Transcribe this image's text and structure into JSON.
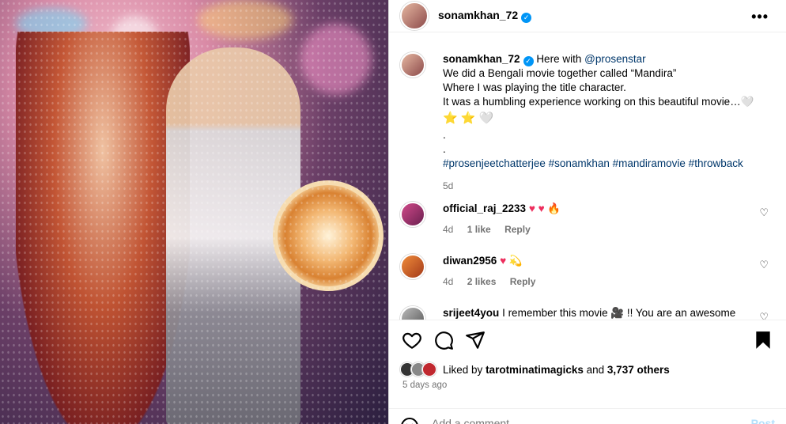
{
  "post": {
    "author": "sonamkhan_72",
    "verified": true,
    "more_label": "•••"
  },
  "caption": {
    "author": "sonamkhan_72",
    "intro": "Here with",
    "mention": "@prosenstar",
    "line1": "We did a Bengali movie together called “Mandira”",
    "line2": "Where I was playing the title character.",
    "line3": "It was a humbling experience working on this beautiful movie…",
    "emoji_line_end": "🤍",
    "emoji_row": [
      "⭐",
      "⭐",
      "🤍"
    ],
    "dot1": ".",
    "dot2": ".",
    "hashtags": "#prosenjeetchatterjee #sonamkhan #mandiramovie #throwback",
    "time": "5d"
  },
  "comments": [
    {
      "username": "official_raj_2233",
      "emojis": [
        "♥",
        "♥",
        "🔥"
      ],
      "time": "4d",
      "likes": "1 like",
      "reply_label": "Reply"
    },
    {
      "username": "diwan2956",
      "emojis": [
        "♥",
        "💫"
      ],
      "time": "4d",
      "likes": "2 likes",
      "reply_label": "Reply"
    },
    {
      "username": "srijeet4you",
      "text": "I remember this movie 🎥 !! You are an awesome"
    }
  ],
  "likes": {
    "prefix": "Liked by",
    "user": "tarotminatimagicks",
    "and": "and",
    "others": "3,737 others"
  },
  "timestamp": "5 days ago",
  "add_comment": {
    "placeholder": "Add a comment…",
    "post_label": "Post"
  },
  "colors": {
    "link": "#00376b",
    "verified": "#0095f6",
    "meta": "#737373",
    "post_disabled": "#b2dffc"
  },
  "icons": {
    "like": "heart-outline-icon",
    "comment": "comment-bubble-icon",
    "share": "paper-plane-icon",
    "save": "bookmark-filled-icon",
    "comment_like": "small-heart-outline-icon",
    "emoji": "smiley-icon",
    "more": "more-dots-icon"
  }
}
